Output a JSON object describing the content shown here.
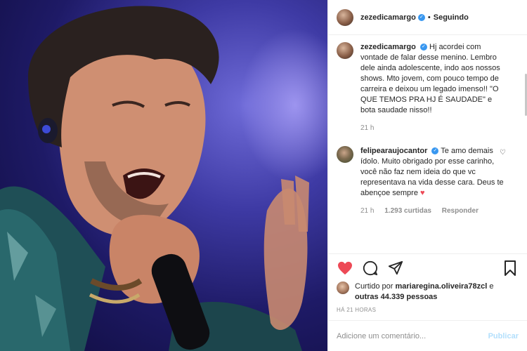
{
  "post": {
    "author": "zezedicamargo",
    "separator": "•",
    "follow_status": "Seguindo",
    "caption": "Hj acordei com vontade de falar desse menino. Lembro dele ainda adolescente, indo aos nossos shows. Mto jovem, com pouco tempo de carreira e deixou um legado imenso!! \"O QUE TEMOS PRA HJ É SAUDADE\" e bota saudade nisso!!",
    "caption_time": "21 h"
  },
  "comments": [
    {
      "author": "felipearaujocantor",
      "text": "Te amo demais ídolo. Muito obrigado por esse carinho, você não faz nem ideia do que vc representava na vida desse cara. Deus te abençoe sempre",
      "emoji": "♥",
      "time": "21 h",
      "likes": "1.293 curtidas",
      "reply": "Responder"
    }
  ],
  "likes": {
    "prefix": "Curtido por",
    "user": "mariaregina.oliveira78zcl",
    "and": "e",
    "others": "outras 44.339 pessoas"
  },
  "time_ago": "HÁ 21 HORAS",
  "add_comment": {
    "placeholder": "Adicione um comentário...",
    "post_label": "Publicar"
  },
  "icons": {
    "verified": "✓",
    "comment_like": "♡"
  },
  "colors": {
    "accent": "#3897f0",
    "like_red": "#ed4956",
    "muted": "#8e8e8e",
    "publish_disabled": "#b2dffc"
  }
}
